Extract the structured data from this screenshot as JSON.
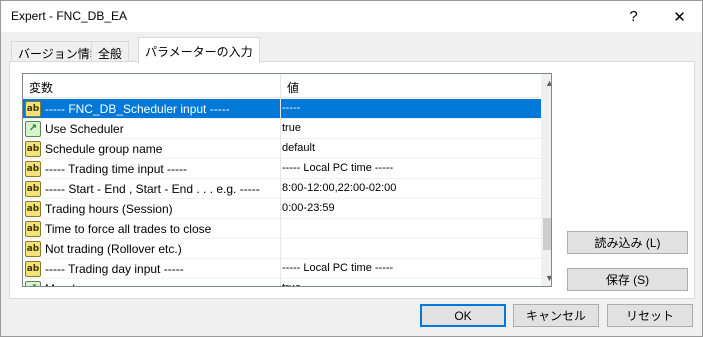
{
  "window": {
    "title": "Expert - FNC_DB_EA"
  },
  "titlebar": {
    "help_label": "?",
    "close_label": "✕"
  },
  "tabs": [
    {
      "label": "バージョン情報"
    },
    {
      "label": "全般"
    },
    {
      "label": "パラメーターの入力"
    }
  ],
  "grid": {
    "columns": {
      "variable": "変数",
      "value": "値"
    },
    "rows": [
      {
        "icon": "ab",
        "name": "----- FNC_DB_Scheduler input -----",
        "value": "-----"
      },
      {
        "icon": "chart",
        "name": "Use Scheduler",
        "value": "true"
      },
      {
        "icon": "ab",
        "name": "Schedule group name",
        "value": "default"
      },
      {
        "icon": "ab",
        "name": "----- Trading time input -----",
        "value": "----- Local PC time -----"
      },
      {
        "icon": "ab",
        "name": "----- Start - End , Start - End . . . e.g. -----",
        "value": "8:00-12:00,22:00-02:00"
      },
      {
        "icon": "ab",
        "name": "Trading hours (Session)",
        "value": "0:00-23:59"
      },
      {
        "icon": "ab",
        "name": "Time to force all trades to close",
        "value": ""
      },
      {
        "icon": "ab",
        "name": "Not trading (Rollover etc.)",
        "value": ""
      },
      {
        "icon": "ab",
        "name": "----- Trading day input -----",
        "value": "----- Local PC time -----"
      },
      {
        "icon": "chart",
        "name": "Monday",
        "value": "true"
      }
    ],
    "scroll": {
      "up": "▲",
      "down": "▼"
    }
  },
  "buttons": {
    "load": "読み込み (L)",
    "save": "保存 (S)",
    "ok": "OK",
    "cancel": "キャンセル",
    "reset": "リセット"
  },
  "icons": {
    "ab_text": "ab",
    "chart_glyph": "↗"
  },
  "colors": {
    "selection": "#0078d7"
  }
}
